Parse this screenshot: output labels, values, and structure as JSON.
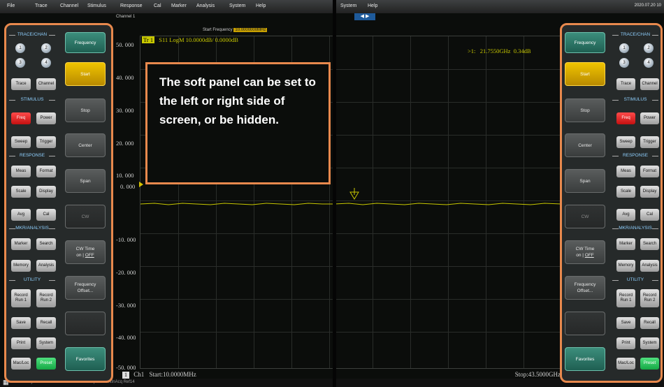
{
  "left_window": {
    "menu": [
      "File",
      "Trace",
      "Channel",
      "Stimulus",
      "Response",
      "Cal",
      "Marker",
      "Analysis",
      "System",
      "Help"
    ],
    "channel_title": "Channel 1",
    "start_frequency_label": "Start Frequency",
    "start_frequency_value": "10.0000000MHz",
    "trace_tag": "Tr 1",
    "trace_info": "S11 LogM 10.0000dB/ 0.0000dB",
    "y_ticks": [
      "50. 000",
      "40. 000",
      "30. 000",
      "20. 000",
      "10. 000",
      "0. 000",
      "-10. 000",
      "-20. 000",
      "-30. 000",
      "-40. 000",
      "-50. 000"
    ],
    "bottom_channel": "Ch1",
    "bottom_start": "Start:10.0000MHz",
    "status_ready": "Ready",
    "status_info": "Ch1  S11  SpaM  ContInAcq  Ref14"
  },
  "right_window": {
    "menu": [
      "System",
      "Help"
    ],
    "datetime": "2020.07.20 10",
    "marker_readout": ">1:   21.7550GHz  0.34dB",
    "bottom_stop": "Stop:43.5000GHz"
  },
  "hardkey_panel": {
    "sections": {
      "trace_chan": "TRACE/CHAN",
      "stimulus": "STIMULUS",
      "response": "RESPONSE",
      "mkr_analysis": "MKR/ANALYSIS",
      "utility": "UTILITY"
    },
    "channel_numbers": [
      "1",
      "2",
      "3",
      "4"
    ],
    "keys": {
      "trace": "Trace",
      "channel": "Channel",
      "freq": "Freq",
      "power": "Power",
      "sweep": "Sweep",
      "trigger": "Trigger",
      "meas": "Meas",
      "format": "Format",
      "scale": "Scale",
      "display": "Display",
      "avg": "Avg",
      "cal": "Cal",
      "marker": "Marker",
      "search": "Search",
      "memory": "Memory",
      "analysis": "Analysis",
      "record1_top": "Record",
      "record1_bottom": "Run 1",
      "record2_top": "Record",
      "record2_bottom": "Run 2",
      "save": "Save",
      "recall": "Recall",
      "print": "Print",
      "system": "System",
      "macloc": "Mac/Loc",
      "preset": "Preset"
    }
  },
  "softkeys": {
    "frequency": "Frequency",
    "start": "Start",
    "stop": "Stop",
    "center": "Center",
    "span": "Span",
    "cw": "CW",
    "cw_time_1": "CW Time",
    "cw_time_on": "on",
    "cw_time_off": "OFF",
    "freq_offset_1": "Frequency",
    "freq_offset_2": "Offset...",
    "favorites": "Favorites"
  },
  "annotation": {
    "text": "The soft panel can be set to the left or right side of screen, or be hidden."
  },
  "colors": {
    "accent_orange": "#e8894d",
    "trace_yellow": "#c8c800",
    "softkey_active": "#f0c400",
    "preset_green": "#15a845",
    "freq_red": "#e01818"
  }
}
